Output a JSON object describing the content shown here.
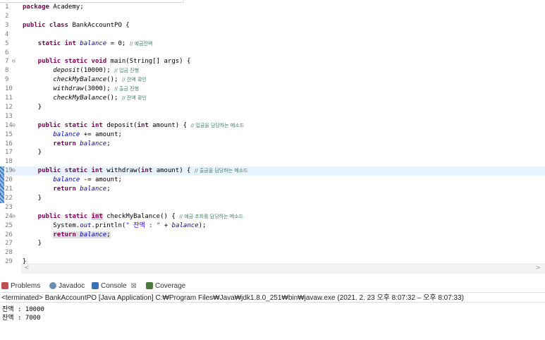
{
  "editor": {
    "lines": [
      {
        "n": "1",
        "fold": "",
        "segs": [
          {
            "t": "package ",
            "c": "kw"
          },
          {
            "t": "Academy;",
            "c": ""
          }
        ]
      },
      {
        "n": "2",
        "fold": "",
        "segs": []
      },
      {
        "n": "3",
        "fold": "",
        "segs": [
          {
            "t": "public class ",
            "c": "kw"
          },
          {
            "t": "BankAccountPO {",
            "c": ""
          }
        ]
      },
      {
        "n": "4",
        "fold": "",
        "segs": []
      },
      {
        "n": "5",
        "fold": "",
        "segs": [
          {
            "t": "    static int ",
            "c": "kw"
          },
          {
            "t": "balance",
            "c": "fld"
          },
          {
            "t": " = 0; ",
            "c": ""
          },
          {
            "t": "// 예금잔액",
            "c": "cm"
          }
        ]
      },
      {
        "n": "6",
        "fold": "",
        "segs": []
      },
      {
        "n": "7",
        "fold": "⊖",
        "segs": [
          {
            "t": "    public static void ",
            "c": "kw"
          },
          {
            "t": "main(String[] args) {",
            "c": ""
          }
        ]
      },
      {
        "n": "8",
        "fold": "",
        "segs": [
          {
            "t": "        ",
            "c": ""
          },
          {
            "t": "deposit",
            "c": "sm"
          },
          {
            "t": "(10000); ",
            "c": ""
          },
          {
            "t": "// 입금 진행",
            "c": "cm"
          }
        ]
      },
      {
        "n": "9",
        "fold": "",
        "segs": [
          {
            "t": "        ",
            "c": ""
          },
          {
            "t": "checkMyBalance",
            "c": "sm"
          },
          {
            "t": "(); ",
            "c": ""
          },
          {
            "t": "// 잔액 확인",
            "c": "cm"
          }
        ]
      },
      {
        "n": "10",
        "fold": "",
        "segs": [
          {
            "t": "        ",
            "c": ""
          },
          {
            "t": "withdraw",
            "c": "sm"
          },
          {
            "t": "(3000); ",
            "c": ""
          },
          {
            "t": "// 출금 진행",
            "c": "cm"
          }
        ]
      },
      {
        "n": "11",
        "fold": "",
        "segs": [
          {
            "t": "        ",
            "c": ""
          },
          {
            "t": "checkMyBalance",
            "c": "sm"
          },
          {
            "t": "(); ",
            "c": ""
          },
          {
            "t": "// 잔액 확인",
            "c": "cm"
          }
        ]
      },
      {
        "n": "12",
        "fold": "",
        "segs": [
          {
            "t": "    }",
            "c": ""
          }
        ]
      },
      {
        "n": "13",
        "fold": "",
        "segs": []
      },
      {
        "n": "14",
        "fold": "⊖",
        "segs": [
          {
            "t": "    public static int ",
            "c": "kw"
          },
          {
            "t": "deposit(",
            "c": ""
          },
          {
            "t": "int ",
            "c": "kw"
          },
          {
            "t": "amount) { ",
            "c": ""
          },
          {
            "t": "// 입금을 담당하는 메소드",
            "c": "cm"
          }
        ]
      },
      {
        "n": "15",
        "fold": "",
        "segs": [
          {
            "t": "        ",
            "c": ""
          },
          {
            "t": "balance",
            "c": "fld"
          },
          {
            "t": " += amount;",
            "c": ""
          }
        ]
      },
      {
        "n": "16",
        "fold": "",
        "segs": [
          {
            "t": "        return ",
            "c": "kw"
          },
          {
            "t": "balance",
            "c": "fld"
          },
          {
            "t": ";",
            "c": ""
          }
        ]
      },
      {
        "n": "17",
        "fold": "",
        "segs": [
          {
            "t": "    }",
            "c": ""
          }
        ]
      },
      {
        "n": "18",
        "fold": "",
        "segs": []
      },
      {
        "n": "19",
        "fold": "⊖",
        "hl": true,
        "bar": true,
        "segs": [
          {
            "t": "    public static int ",
            "c": "kw"
          },
          {
            "t": "withdraw(",
            "c": ""
          },
          {
            "t": "int ",
            "c": "kw"
          },
          {
            "t": "amount) { ",
            "c": ""
          },
          {
            "t": "// 출금을 담당하는 메소드",
            "c": "cm"
          }
        ]
      },
      {
        "n": "20",
        "fold": "",
        "bar": true,
        "segs": [
          {
            "t": "        ",
            "c": ""
          },
          {
            "t": "balance",
            "c": "fld"
          },
          {
            "t": " -= amount;",
            "c": ""
          }
        ]
      },
      {
        "n": "21",
        "fold": "",
        "bar": true,
        "segs": [
          {
            "t": "        return ",
            "c": "kw"
          },
          {
            "t": "balance",
            "c": "fld"
          },
          {
            "t": ";",
            "c": ""
          }
        ]
      },
      {
        "n": "22",
        "fold": "",
        "bar": true,
        "segs": [
          {
            "t": "    }",
            "c": ""
          }
        ]
      },
      {
        "n": "23",
        "fold": "",
        "segs": []
      },
      {
        "n": "24",
        "fold": "⊖",
        "segs": [
          {
            "t": "    public static ",
            "c": "kw"
          },
          {
            "t": "int",
            "c": "kw mark"
          },
          {
            "t": " checkMyBalance() { ",
            "c": ""
          },
          {
            "t": "// 예금 조회를 담당하는 메소드",
            "c": "cm"
          }
        ]
      },
      {
        "n": "25",
        "fold": "",
        "segs": [
          {
            "t": "        System.",
            "c": ""
          },
          {
            "t": "out",
            "c": "fld"
          },
          {
            "t": ".println(",
            "c": ""
          },
          {
            "t": "\" 잔액 : \"",
            "c": "st"
          },
          {
            "t": " + ",
            "c": ""
          },
          {
            "t": "balance",
            "c": "fld"
          },
          {
            "t": ");",
            "c": ""
          }
        ]
      },
      {
        "n": "26",
        "fold": "",
        "segs": [
          {
            "t": "        ",
            "c": ""
          },
          {
            "t": "return ",
            "c": "kw mark2"
          },
          {
            "t": "balance",
            "c": "fld mark2"
          },
          {
            "t": ";",
            "c": "mark2"
          }
        ]
      },
      {
        "n": "27",
        "fold": "",
        "segs": [
          {
            "t": "    }",
            "c": ""
          }
        ]
      },
      {
        "n": "28",
        "fold": "",
        "segs": []
      },
      {
        "n": "29",
        "fold": "",
        "segs": [
          {
            "t": "}",
            "c": ""
          }
        ]
      }
    ]
  },
  "scrollbar": {
    "left_arrow": "<",
    "right_arrow": ">"
  },
  "panel": {
    "tabs": [
      {
        "label": "Problems",
        "icon": "problems-icon",
        "color": "#c05050"
      },
      {
        "label": "Javadoc",
        "icon": "javadoc-icon",
        "color": "#6b8fb3"
      },
      {
        "label": "Console",
        "icon": "console-icon",
        "color": "#3d6fb4",
        "close": "⊠",
        "active": true
      },
      {
        "label": "Coverage",
        "icon": "coverage-icon",
        "color": "#4a7a3a"
      }
    ],
    "status": "<terminated> BankAccountPO [Java Application] C:₩Program Files₩Java₩jdk1.8.0_251₩bin₩javaw.exe  (2021. 2. 23 오후 8:07:32 – 오후 8:07:33)",
    "output": [
      "잔액 : 10000",
      "잔액 : 7000"
    ]
  }
}
